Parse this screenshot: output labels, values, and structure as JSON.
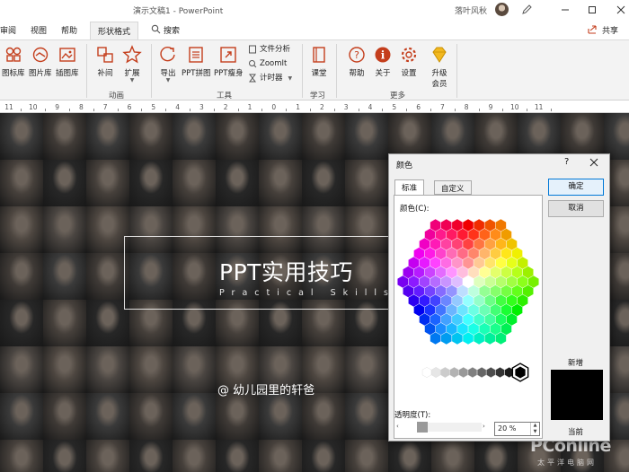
{
  "window": {
    "doc_title": "演示文稿1 - PowerPoint",
    "user_name": "落叶风秋"
  },
  "tabs": {
    "items": [
      "审阅",
      "视图",
      "帮助",
      "形状格式"
    ],
    "search_label": "搜索",
    "share_label": "共享"
  },
  "ribbon": {
    "buttons": {
      "icon_lib": "图标库",
      "image_lib": "图片库",
      "illustration_lib": "插图库",
      "tween": "补间",
      "extend": "扩展",
      "export": "导出",
      "ppt_puzzle": "PPT拼图",
      "ppt_slim": "PPT瘦身",
      "file_analysis": "文件分析",
      "zoomit": "ZoomIt",
      "timer": "计时器",
      "classroom": "课堂",
      "help": "帮助",
      "about": "关于",
      "settings": "设置",
      "upgrade_line1": "升级",
      "upgrade_line2": "会员"
    },
    "groups": {
      "animation": "动画",
      "tools": "工具",
      "learn": "学习",
      "more": "更多"
    },
    "colors": {
      "accent_red": "#c43e1c",
      "gold": "#f2b81f"
    }
  },
  "ruler": {
    "ticks": [
      "11",
      "10",
      "9",
      "8",
      "7",
      "6",
      "5",
      "4",
      "3",
      "2",
      "1",
      "0",
      "1",
      "2",
      "3",
      "4",
      "5",
      "6",
      "7",
      "8",
      "9",
      "10",
      "11"
    ]
  },
  "slide": {
    "title": "PPT实用技巧",
    "subtitle": "Practical Skills",
    "author": "@ 幼儿园里的轩爸",
    "watermark_brand": "PConline",
    "watermark_sub": "太平洋电脑网"
  },
  "color_dialog": {
    "title": "颜色",
    "help": "?",
    "tab_standard": "标准",
    "tab_custom": "自定义",
    "colors_label": "颜色(C):",
    "ok_button": "确定",
    "cancel_button": "取消",
    "new_label": "新增",
    "current_label": "当前",
    "transparency_label": "透明度(T):",
    "transparency_value": "20 %",
    "new_color": "#000000",
    "current_color": "#000000"
  }
}
